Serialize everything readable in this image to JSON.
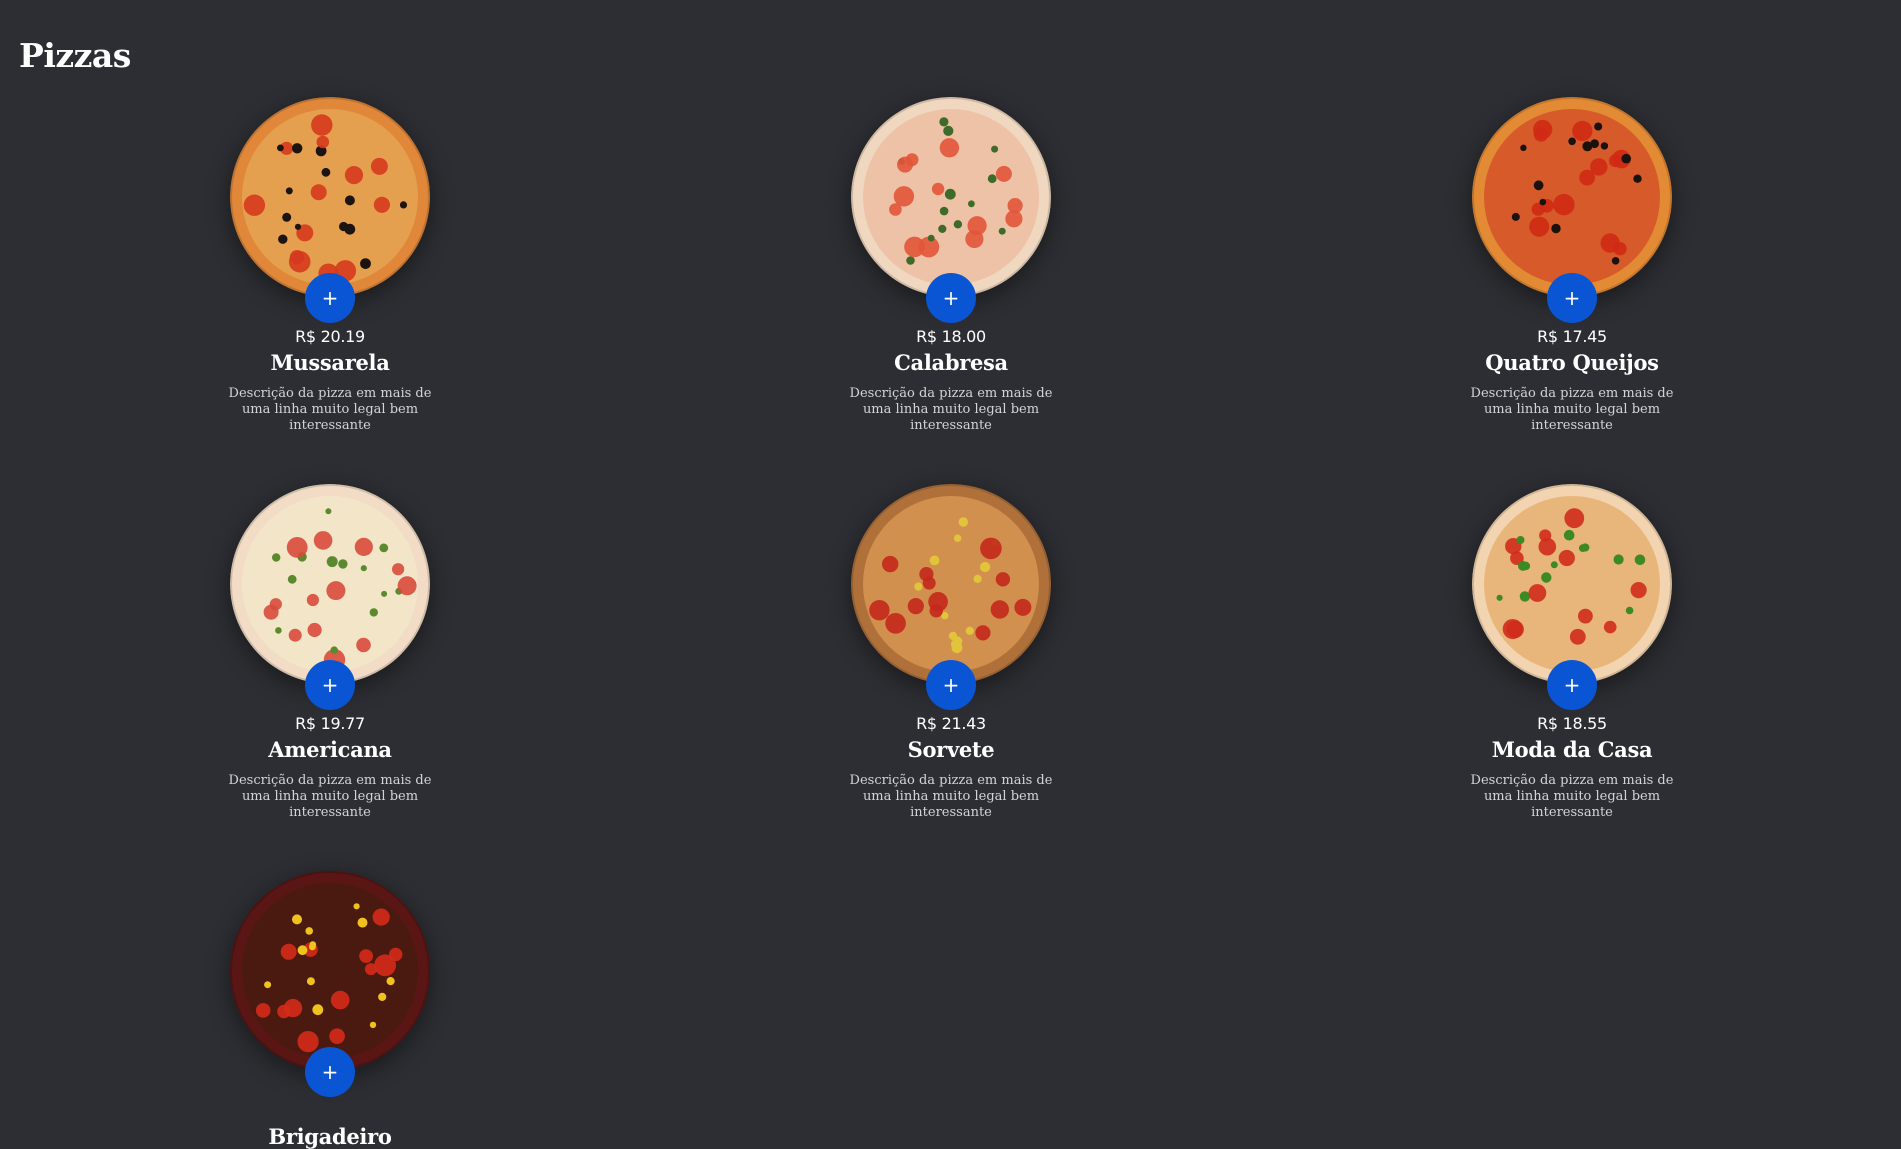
{
  "page": {
    "title": "Pizzas"
  },
  "add_label": "+",
  "pizzas": [
    {
      "name": "Mussarela",
      "price": "R$ 20.19",
      "description": "Descrição da pizza em mais de uma linha muito legal bem interessante",
      "colors": {
        "crust": "#e0873a",
        "sauce": "#e4a04e",
        "topping": "#d63a1e",
        "accent": "#1c1410"
      }
    },
    {
      "name": "Calabresa",
      "price": "R$ 18.00",
      "description": "Descrição da pizza em mais de uma linha muito legal bem interessante",
      "colors": {
        "crust": "#f0d8c0",
        "sauce": "#eec2a6",
        "topping": "#e2553a",
        "accent": "#3f6b2a"
      }
    },
    {
      "name": "Quatro Queijos",
      "price": "R$ 17.45",
      "description": "Descrição da pizza em mais de uma linha muito legal bem interessante",
      "colors": {
        "crust": "#e38a35",
        "sauce": "#d65a2a",
        "topping": "#cf2a14",
        "accent": "#1b120d"
      }
    },
    {
      "name": "Americana",
      "price": "R$ 19.77",
      "description": "Descrição da pizza em mais de uma linha muito legal bem interessante",
      "colors": {
        "crust": "#f2dcc6",
        "sauce": "#f3e6c8",
        "topping": "#d84a3c",
        "accent": "#5b8a2e"
      }
    },
    {
      "name": "Sorvete",
      "price": "R$ 21.43",
      "description": "Descrição da pizza em mais de uma linha muito legal bem interessante",
      "colors": {
        "crust": "#b0703a",
        "sauce": "#d2904e",
        "topping": "#c3281c",
        "accent": "#e2c43a"
      }
    },
    {
      "name": "Moda da Casa",
      "price": "R$ 18.55",
      "description": "Descrição da pizza em mais de uma linha muito legal bem interessante",
      "colors": {
        "crust": "#f2d4b0",
        "sauce": "#e8b67a",
        "topping": "#d02c1c",
        "accent": "#3d8a24"
      }
    },
    {
      "name": "Brigadeiro",
      "price": "",
      "description": "",
      "colors": {
        "crust": "#5a1614",
        "sauce": "#4a1a10",
        "topping": "#d62a18",
        "accent": "#f0c21e"
      }
    }
  ]
}
